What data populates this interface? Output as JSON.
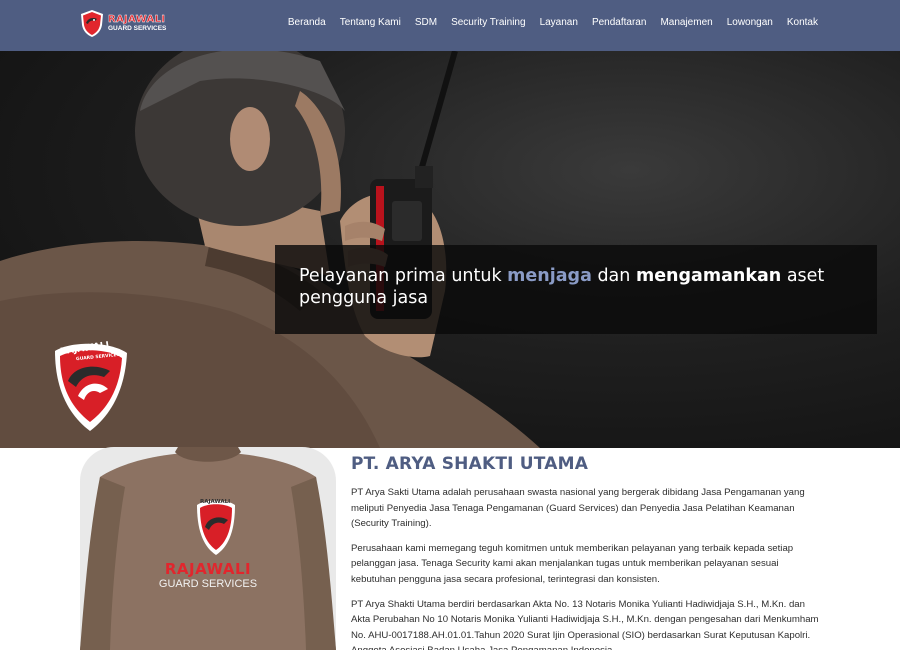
{
  "brand": {
    "name": "RAJAWALI",
    "tagline": "GUARD SERVICES",
    "primary_color": "#4f5d82",
    "accent_color": "#e1262d"
  },
  "nav": {
    "items": [
      {
        "label": "Beranda"
      },
      {
        "label": "Tentang Kami"
      },
      {
        "label": "SDM"
      },
      {
        "label": "Security Training"
      },
      {
        "label": "Layanan"
      },
      {
        "label": "Pendaftaran"
      },
      {
        "label": "Manajemen"
      },
      {
        "label": "Lowongan"
      },
      {
        "label": "Kontak"
      }
    ]
  },
  "hero": {
    "text_1": "Pelayanan prima untuk ",
    "highlight_1": "menjaga",
    "text_2": " dan ",
    "highlight_2": "mengamankan",
    "text_3": " aset pengguna jasa",
    "badge_name": "RAJAWALI",
    "badge_sub": "GUARD SERVICES"
  },
  "about": {
    "photo_brand": "RAJAWALI",
    "photo_sub": "GUARD SERVICES",
    "photo_badge": "RAJAWALI",
    "title": "PT. ARYA SHAKTI UTAMA",
    "paragraphs": [
      "PT Arya Sakti Utama adalah perusahaan swasta nasional yang bergerak dibidang Jasa Pengamanan yang meliputi Penyedia Jasa Tenaga Pengamanan (Guard Services) dan Penyedia Jasa Pelatihan Keamanan (Security Training).",
      "Perusahaan kami memegang teguh komitmen untuk memberikan pelayanan yang terbaik kepada setiap pelanggan jasa. Tenaga Security kami akan menjalankan tugas untuk memberikan pelayanan sesuai kebutuhan pengguna jasa secara profesional, terintegrasi dan konsisten.",
      "PT Arya Shakti Utama berdiri berdasarkan Akta No. 13 Notaris Monika Yulianti Hadiwidjaja S.H., M.Kn. dan Akta Perubahan No 10 Notaris Monika Yulianti Hadiwidjaja S.H., M.Kn. dengan pengesahan dari Menkumham No. AHU-0017188.AH.01.01.Tahun 2020 Surat Ijin Operasional (SIO) berdasarkan Surat Keputusan Kapolri. Anggota Asosiasi Badan Usaha Jasa Pengamanan Indonesia"
    ]
  }
}
